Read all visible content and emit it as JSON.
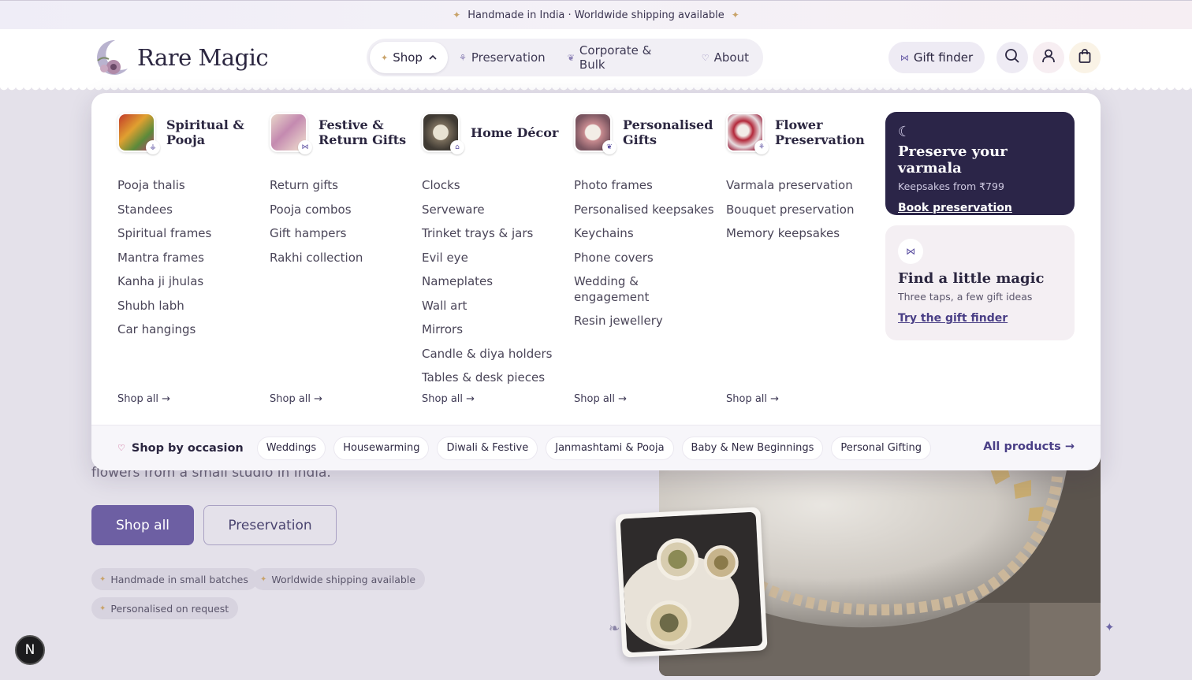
{
  "announcement": {
    "text": "Handmade in India · Worldwide shipping available",
    "spark": "✦"
  },
  "brand": {
    "name": "Rare Magic"
  },
  "nav": {
    "items": [
      {
        "label": "Shop",
        "icon": "sparkle-icon"
      },
      {
        "label": "Preservation",
        "icon": "flower-icon"
      },
      {
        "label": "Corporate & Bulk",
        "icon": "leaf-icon"
      },
      {
        "label": "About",
        "icon": "heart-icon"
      }
    ],
    "gift_finder": "Gift finder"
  },
  "mega_menu": {
    "columns": [
      {
        "title": "Spiritual & Pooja",
        "links": [
          "Pooja thalis",
          "Standees",
          "Spiritual frames",
          "Mantra frames",
          "Kanha ji jhulas",
          "Shubh labh",
          "Car hangings"
        ],
        "shop_all": "Shop all →"
      },
      {
        "title": "Festive & Return Gifts",
        "links": [
          "Return gifts",
          "Pooja combos",
          "Gift hampers",
          "Rakhi collection"
        ],
        "shop_all": "Shop all →"
      },
      {
        "title": "Home Décor",
        "links": [
          "Clocks",
          "Serveware",
          "Trinket trays & jars",
          "Evil eye",
          "Nameplates",
          "Wall art",
          "Mirrors",
          "Candle & diya holders",
          "Tables & desk pieces"
        ],
        "shop_all": "Shop all →"
      },
      {
        "title": "Personalised Gifts",
        "links": [
          "Photo frames",
          "Personalised keepsakes",
          "Keychains",
          "Phone covers",
          "Wedding & engagement",
          "Resin jewellery"
        ],
        "shop_all": "Shop all →"
      },
      {
        "title": "Flower Preservation",
        "links": [
          "Varmala preservation",
          "Bouquet preservation",
          "Memory keepsakes"
        ],
        "shop_all": "Shop all →"
      }
    ],
    "promo_preserve": {
      "title": "Preserve your varmala",
      "subtitle": "Keepsakes from ₹799",
      "link": "Book preservation"
    },
    "promo_gift": {
      "title": "Find a little magic",
      "subtitle": "Three taps, a few gift ideas",
      "link": "Try the gift finder"
    },
    "occasion": {
      "label": "Shop by occasion",
      "chips": [
        "Weddings",
        "Housewarming",
        "Diwali & Festive",
        "Janmashtami & Pooja",
        "Baby & New Beginnings",
        "Personal Gifting"
      ],
      "all_products": "All products →"
    }
  },
  "hero": {
    "text_fragment": "flowers from a small studio in India.",
    "primary_cta": "Shop all",
    "secondary_cta": "Preservation",
    "badges": [
      "Handmade in small batches",
      "Worldwide shipping available",
      "Personalised on request"
    ]
  },
  "dev_badge": "N"
}
